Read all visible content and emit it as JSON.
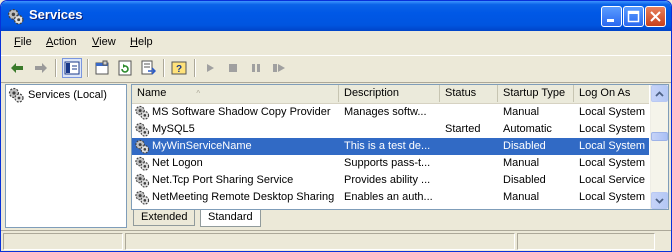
{
  "window": {
    "title": "Services"
  },
  "menu": [
    {
      "label": "File",
      "u": "F",
      "rest": "ile"
    },
    {
      "label": "Action",
      "u": "A",
      "rest": "ction"
    },
    {
      "label": "View",
      "u": "V",
      "rest": "iew"
    },
    {
      "label": "Help",
      "u": "H",
      "rest": "elp"
    }
  ],
  "toolbar": {
    "icons": [
      "back-arrow-icon",
      "forward-arrow-icon",
      "show-hide-tree-icon",
      "properties-icon",
      "refresh-icon",
      "export-list-icon",
      "help-icon",
      "start-service-icon",
      "stop-service-icon",
      "pause-service-icon",
      "restart-service-icon"
    ]
  },
  "tree": {
    "root_label": "Services (Local)"
  },
  "list": {
    "columns": {
      "name": "Name",
      "description": "Description",
      "status": "Status",
      "startup": "Startup Type",
      "logon": "Log On As"
    },
    "sort_indicator": "^",
    "rows": [
      {
        "name": "MS Software Shadow Copy Provider",
        "description": "Manages softw...",
        "status": "",
        "startup": "Manual",
        "logon": "Local System"
      },
      {
        "name": "MySQL5",
        "description": "",
        "status": "Started",
        "startup": "Automatic",
        "logon": "Local System"
      },
      {
        "name": "MyWinServiceName",
        "description": "This is a test de...",
        "status": "",
        "startup": "Disabled",
        "logon": "Local System"
      },
      {
        "name": "Net Logon",
        "description": "Supports pass-t...",
        "status": "",
        "startup": "Manual",
        "logon": "Local System"
      },
      {
        "name": "Net.Tcp Port Sharing Service",
        "description": "Provides ability ...",
        "status": "",
        "startup": "Disabled",
        "logon": "Local Service"
      },
      {
        "name": "NetMeeting Remote Desktop Sharing",
        "description": "Enables an auth...",
        "status": "",
        "startup": "Manual",
        "logon": "Local System"
      }
    ],
    "selected_row": "MyWinServiceName"
  },
  "tabs": {
    "extended": "Extended",
    "standard": "Standard",
    "active": "Standard"
  },
  "colors": {
    "titlebar": "#0058e6",
    "selection": "#316ac5",
    "face": "#ece9d8"
  }
}
